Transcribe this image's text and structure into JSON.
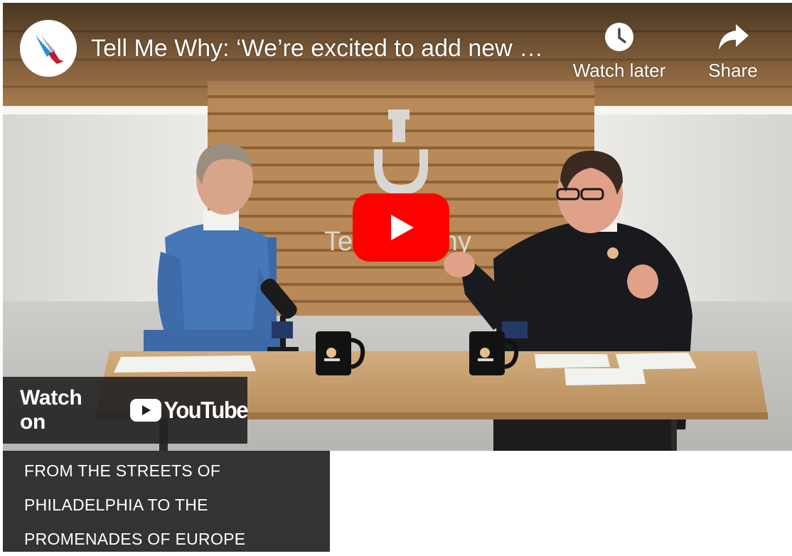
{
  "video": {
    "title": "Tell Me Why: ‘We’re excited to add new …",
    "channel_logo": "american-airlines-logo",
    "actions": {
      "watch_later": {
        "label": "Watch later",
        "icon": "clock-icon"
      },
      "share": {
        "label": "Share",
        "icon": "share-arrow-icon"
      }
    },
    "play_icon": "play-icon",
    "set_wall_sign": "Tell Me Why",
    "watch_on": {
      "prefix": "Watch on",
      "brand": "YouTube"
    }
  },
  "caption": {
    "lines": [
      "FROM THE STREETS OF",
      "PHILADELPHIA TO THE",
      "PROMENADES OF EUROPE"
    ]
  },
  "colors": {
    "youtube_red": "#ff0000",
    "caption_bg": "#333333",
    "overlay_bg": "#212121"
  }
}
